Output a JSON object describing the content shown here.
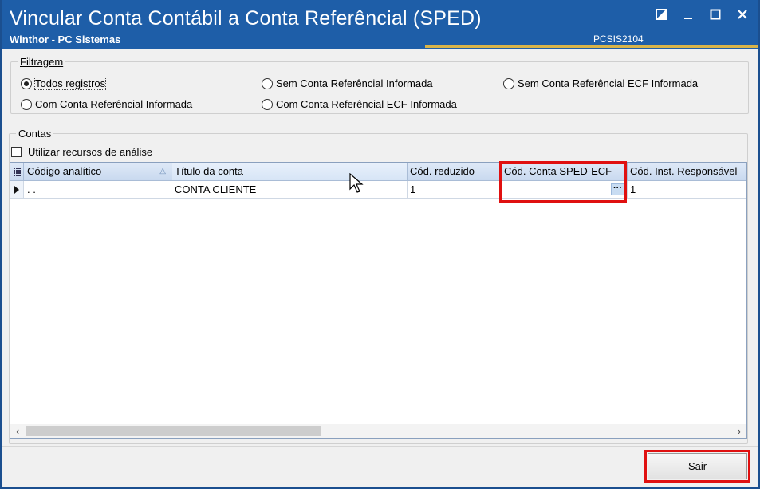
{
  "window": {
    "title": "Vincular Conta Contábil a Conta Referêncial (SPED)",
    "subtitle": "Winthor - PC Sistemas",
    "program_code": "PCSIS2104",
    "controls": [
      "restore-icon",
      "minimize-icon",
      "maximize-icon",
      "close-icon"
    ]
  },
  "filter": {
    "legend": "Filtragem",
    "options": [
      {
        "label": "Todos registros",
        "checked": true
      },
      {
        "label": "Sem Conta Referêncial Informada",
        "checked": false
      },
      {
        "label": "Sem Conta Referêncial ECF Informada",
        "checked": false
      },
      {
        "label": "Com Conta Referêncial Informada",
        "checked": false
      },
      {
        "label": "Com Conta Referêncial ECF Informada",
        "checked": false
      }
    ]
  },
  "contas": {
    "legend": "Contas",
    "checkbox_label": "Utilizar recursos de análise",
    "checkbox_checked": false
  },
  "grid": {
    "columns": [
      "Código analítico",
      "Título da conta",
      "Cód. reduzido",
      "Cód. Conta SPED-ECF",
      "Cód. Inst. Responsável"
    ],
    "rows": [
      {
        "codigo_analitico": ". .",
        "titulo": "CONTA CLIENTE",
        "cod_reduzido": "1",
        "cod_sped_ecf": "",
        "cod_inst": "1"
      }
    ],
    "ellipsis_label": "···"
  },
  "footer": {
    "sair_label_first": "S",
    "sair_label_rest": "air"
  },
  "colors": {
    "titlebar": "#1e5ea8",
    "frame": "#1b4f8f",
    "highlight": "#e01010",
    "accent_line": "#d8b44a"
  }
}
